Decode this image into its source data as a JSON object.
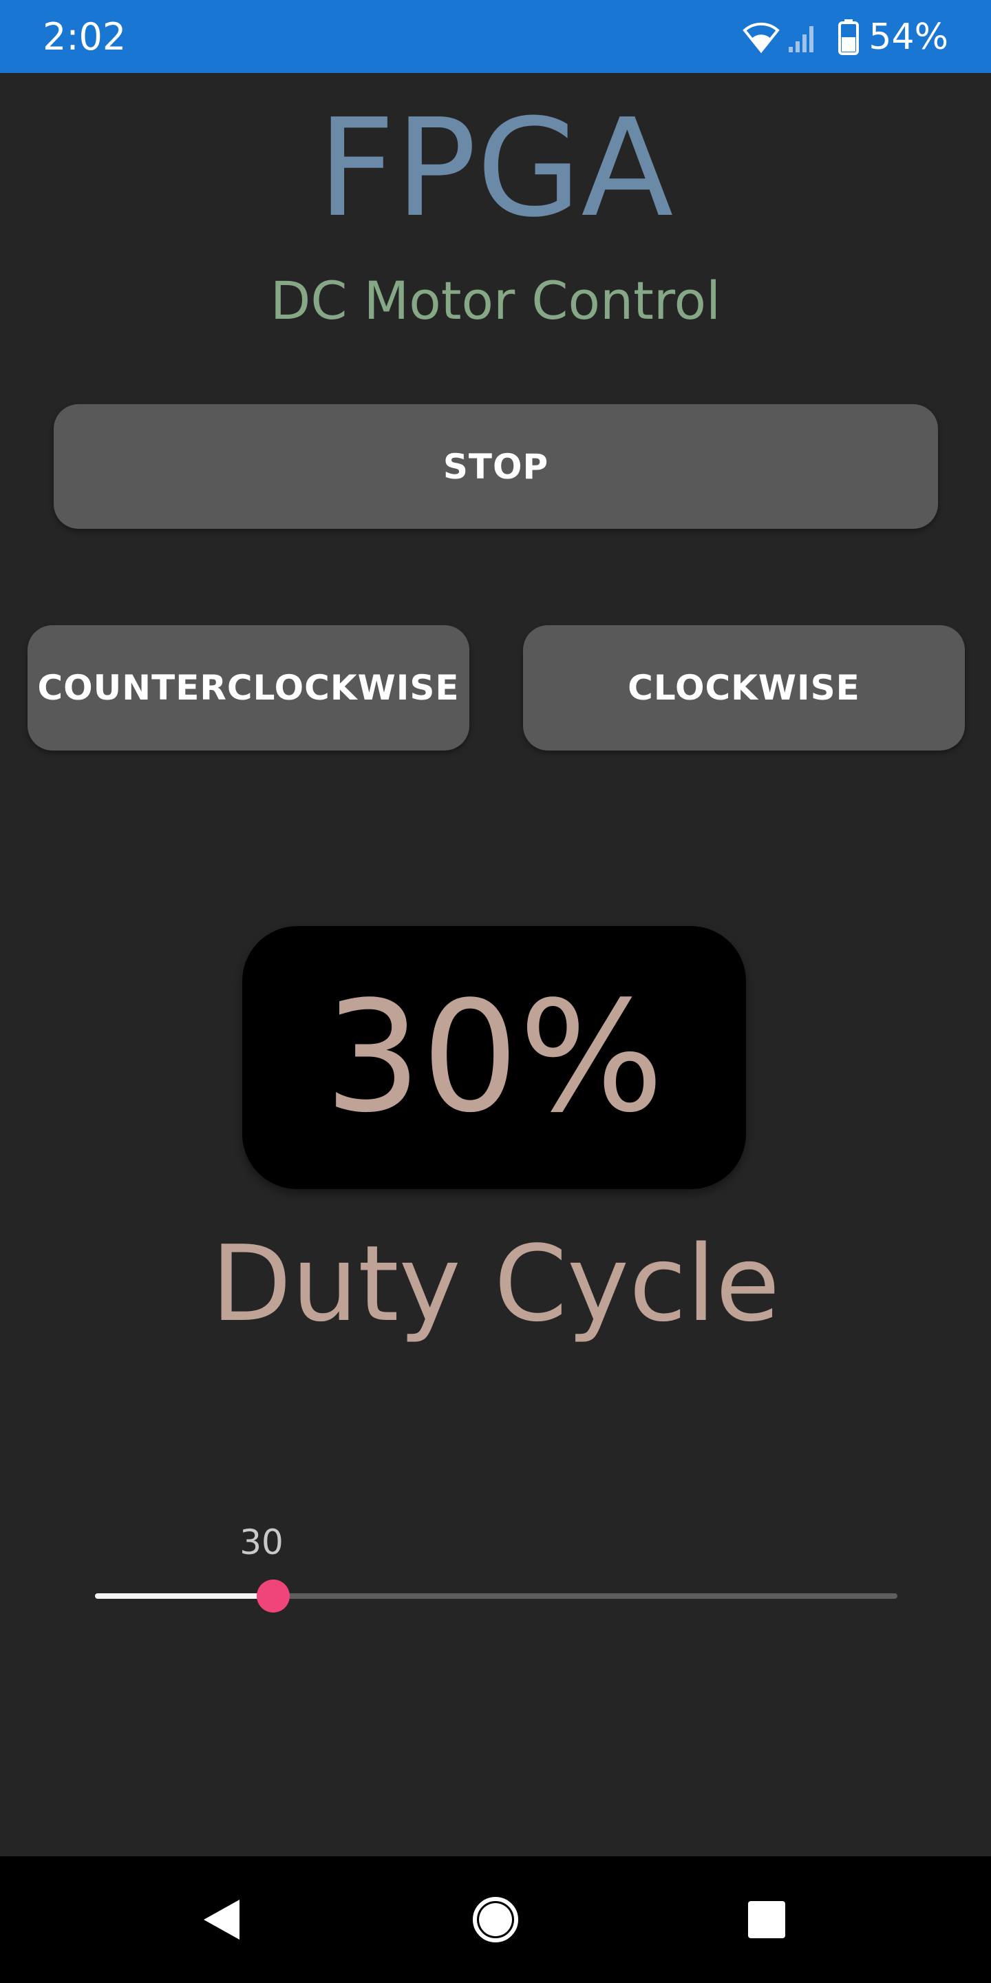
{
  "status_bar": {
    "time": "2:02",
    "battery_percent": "54%",
    "icons": [
      "wifi-icon",
      "cellular-signal-icon",
      "battery-icon"
    ],
    "background_color": "#1976d2"
  },
  "header": {
    "title": "FPGA",
    "subtitle": "DC Motor Control"
  },
  "controls": {
    "stop_label": "STOP",
    "counterclockwise_label": "COUNTERCLOCKWISE",
    "clockwise_label": "CLOCKWISE"
  },
  "duty": {
    "display": "30%",
    "label": "Duty Cycle"
  },
  "slider": {
    "value_label": "30",
    "value": 30,
    "min": 0,
    "max": 135,
    "thumb_color": "#f0457b"
  },
  "nav_bar": {
    "icons": [
      "back-icon",
      "home-icon",
      "recents-icon"
    ]
  },
  "colors": {
    "background": "#252525",
    "title": "#6a8aa8",
    "subtitle": "#86a886",
    "button": "#595959",
    "duty_text": "#c0a397"
  }
}
